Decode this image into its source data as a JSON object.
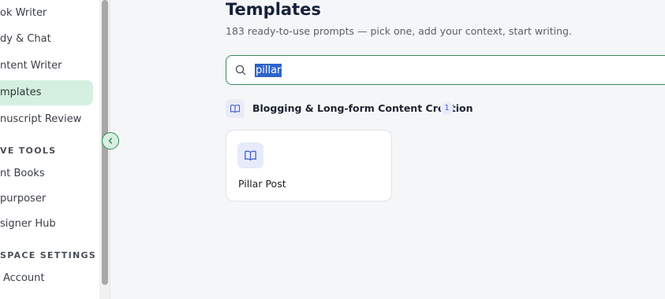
{
  "sidebar": {
    "items": [
      {
        "label": "ok Writer"
      },
      {
        "label": "dy & Chat"
      },
      {
        "label": "ntent Writer"
      },
      {
        "label": "mplates",
        "active": true
      },
      {
        "label": "nuscript Review"
      }
    ],
    "section_creative": "VE TOOLS",
    "creative_items": [
      {
        "label": "nt Books"
      },
      {
        "label": "purposer"
      },
      {
        "label": "signer Hub"
      }
    ],
    "section_workspace": "SPACE SETTINGS",
    "workspace_items": [
      {
        "label": "Account"
      }
    ]
  },
  "main": {
    "title": "Templates",
    "subtitle": "183 ready-to-use prompts — pick one, add your context, start writing.",
    "search": {
      "value": "pillar",
      "placeholder": ""
    },
    "category": {
      "title": "Blogging & Long-form Content Creation",
      "count": "1"
    },
    "cards": [
      {
        "title": "Pillar Post"
      }
    ]
  },
  "colors": {
    "accent_green": "#2f8a56",
    "active_bg": "#d5efe1",
    "indigo_icon": "#4c5fc9",
    "selection": "#2d63c8"
  },
  "icons": {
    "collapse": "chevron-left-icon",
    "search": "search-icon",
    "category": "book-open-icon",
    "card": "book-open-icon"
  }
}
